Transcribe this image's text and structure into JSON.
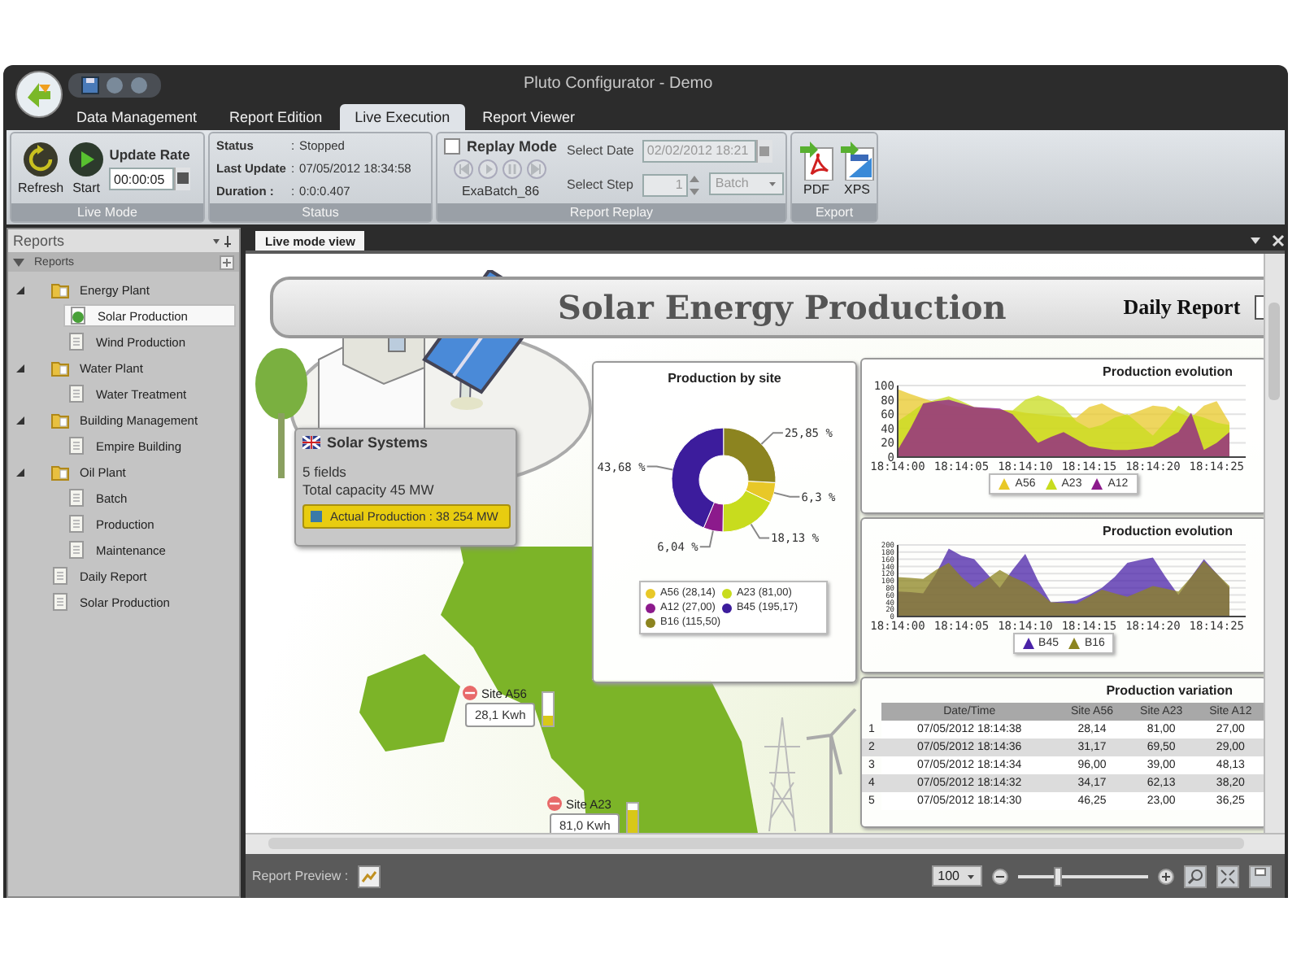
{
  "window": {
    "title": "Pluto Configurator - Demo"
  },
  "ribbon_tabs": [
    {
      "label": "Data Management",
      "selected": false
    },
    {
      "label": "Report Edition",
      "selected": false
    },
    {
      "label": "Live Execution",
      "selected": true
    },
    {
      "label": "Report Viewer",
      "selected": false
    }
  ],
  "ribbon": {
    "live_mode": {
      "label": "Live Mode",
      "buttons": [
        {
          "label": "Refresh",
          "kind": "refresh"
        },
        {
          "label": "Start",
          "kind": "start"
        }
      ],
      "update_rate": {
        "label": "Update Rate",
        "value": "00:00:05"
      }
    },
    "status": {
      "label": "Status",
      "rows": [
        {
          "name": "Status",
          "separator": ":",
          "value": "Stopped"
        },
        {
          "name": "Last Update",
          "separator": ":",
          "value": "07/05/2012 18:34:58"
        },
        {
          "name": "Duration :",
          "separator": ":",
          "value": "0:0:0.407"
        }
      ]
    },
    "report_replay": {
      "label": "Report Replay",
      "replay_mode": {
        "label": "Replay Mode",
        "checked": false
      },
      "media_buttons": [
        {
          "kind": "first",
          "disabled": true
        },
        {
          "kind": "play",
          "disabled": true
        },
        {
          "kind": "pause",
          "disabled": true
        },
        {
          "kind": "last",
          "disabled": true
        }
      ],
      "batch": "ExaBatch_86",
      "select_date": {
        "label": "Select Date",
        "value": "02/02/2012 18:21",
        "disabled": true
      },
      "select_step": {
        "label": "Select Step",
        "value": "1",
        "disabled": true
      },
      "step_unit": {
        "value": "Batch",
        "disabled": true
      }
    },
    "export": {
      "label": "Export",
      "buttons": [
        {
          "label": "PDF",
          "kind": "pdf"
        },
        {
          "label": "XPS",
          "kind": "xps"
        }
      ]
    }
  },
  "reports_panel": {
    "title": "Reports",
    "root": {
      "label": "Reports",
      "expanded": true
    },
    "items": [
      {
        "label": "Energy Plant",
        "kind": "folder",
        "expanded": true,
        "selected": false,
        "children": [
          {
            "label": "Solar Production",
            "kind": "live_report",
            "selected": true
          },
          {
            "label": "Wind Production",
            "kind": "report",
            "selected": false
          }
        ]
      },
      {
        "label": "Water Plant",
        "kind": "folder",
        "expanded": true,
        "selected": false,
        "children": [
          {
            "label": "Water Treatment",
            "kind": "report",
            "selected": false
          }
        ]
      },
      {
        "label": "Building Management",
        "kind": "folder",
        "expanded": true,
        "selected": false,
        "children": [
          {
            "label": "Empire Building",
            "kind": "report",
            "selected": false
          }
        ]
      },
      {
        "label": "Oil Plant",
        "kind": "folder",
        "expanded": true,
        "selected": false,
        "children": [
          {
            "label": "Batch",
            "kind": "report",
            "selected": false
          },
          {
            "label": "Production",
            "kind": "report",
            "selected": false
          },
          {
            "label": "Maintenance",
            "kind": "report",
            "selected": false
          }
        ]
      },
      {
        "label": "Daily Report",
        "kind": "report",
        "selected": false
      },
      {
        "label": "Solar Production",
        "kind": "report",
        "selected": false
      }
    ]
  },
  "document_tabs": [
    {
      "label": "Live mode view",
      "selected": true
    }
  ],
  "report": {
    "title": "Solar Energy Production",
    "subtitle": "Daily Report",
    "info_card": {
      "title": "Solar Systems",
      "lines": [
        "5 fields",
        "Total capacity 45 MW"
      ],
      "button": "Actual Production : 38 254 MW"
    },
    "sites": [
      {
        "name": "Site A56",
        "reading": "28,1 Kwh",
        "level": 0.3
      },
      {
        "name": "Site A23",
        "reading": "81,0 Kwh",
        "level": 0.8
      }
    ],
    "donut_panel": {
      "chart_data": {
        "type": "donut",
        "title": "Production by site",
        "categories": [
          "A56 (28,14)",
          "A23 (81,00)",
          "A12 (27,00)",
          "B45 (195,17)",
          "B16 (115,50)"
        ],
        "values": [
          6.3,
          18.13,
          6.04,
          43.68,
          25.85
        ],
        "value_labels": [
          "6,3 %",
          "18,13 %",
          "6,04 %",
          "43,68 %",
          "25,85 %"
        ],
        "colors": [
          "#e8c828",
          "#c8dc1e",
          "#8c1a8c",
          "#3c1c9c",
          "#8c8420"
        ]
      }
    },
    "evolution_charts": [
      {
        "chart_data": {
          "type": "area",
          "title": "Production evolution",
          "grid": true,
          "categories": [
            "18:14:00",
            null,
            null,
            null,
            null,
            "18:14:05",
            null,
            null,
            null,
            null,
            "18:14:10",
            null,
            null,
            null,
            null,
            "18:14:15",
            null,
            null,
            null,
            null,
            "18:14:20",
            null,
            null,
            null,
            null,
            "18:14:25",
            null
          ],
          "ylim": [
            0,
            100
          ],
          "yticks": [
            0,
            20,
            40,
            60,
            80,
            100
          ],
          "series": [
            {
              "name": "A56",
              "color": "#e8c828",
              "values": [
                95,
                88,
                82,
                76,
                72,
                70,
                68,
                68,
                66,
                65,
                62,
                60,
                58,
                56,
                55,
                70,
                75,
                65,
                58,
                65,
                72,
                70,
                62,
                55,
                72,
                78,
                48
              ]
            },
            {
              "name": "A23",
              "color": "#c8dc1e",
              "values": [
                50,
                62,
                75,
                80,
                85,
                78,
                70,
                68,
                66,
                65,
                80,
                86,
                80,
                70,
                50,
                40,
                45,
                55,
                60,
                45,
                30,
                50,
                72,
                60,
                55,
                48,
                45
              ]
            },
            {
              "name": "A12",
              "color": "#8c1a8c",
              "values": [
                10,
                40,
                75,
                78,
                80,
                75,
                70,
                69,
                68,
                60,
                40,
                20,
                28,
                35,
                25,
                15,
                12,
                10,
                10,
                12,
                15,
                25,
                35,
                62,
                10,
                20,
                35
              ]
            }
          ]
        }
      },
      {
        "chart_data": {
          "type": "area",
          "title": "Production evolution",
          "grid": true,
          "categories": [
            "18:14:00",
            null,
            null,
            null,
            null,
            "18:14:05",
            null,
            null,
            null,
            null,
            "18:14:10",
            null,
            null,
            null,
            null,
            "18:14:15",
            null,
            null,
            null,
            null,
            "18:14:20",
            null,
            null,
            null,
            null,
            "18:14:25",
            null
          ],
          "ylim": [
            0,
            200
          ],
          "yticks": [
            0,
            20,
            40,
            60,
            80,
            100,
            120,
            140,
            160,
            180,
            200
          ],
          "series": [
            {
              "name": "B45",
              "color": "#4a22a8",
              "values": [
                70,
                68,
                65,
                120,
                190,
                170,
                160,
                120,
                80,
                130,
                175,
                100,
                40,
                42,
                45,
                60,
                80,
                110,
                150,
                158,
                165,
                110,
                60,
                110,
                160,
                120,
                80
              ]
            },
            {
              "name": "B16",
              "color": "#8c8420",
              "values": [
                110,
                108,
                105,
                130,
                150,
                110,
                80,
                105,
                130,
                110,
                95,
                70,
                40,
                38,
                35,
                55,
                75,
                65,
                55,
                70,
                85,
                78,
                70,
                110,
                155,
                120,
                85
              ]
            }
          ]
        }
      }
    ],
    "table": {
      "title": "Production variation",
      "columns": [
        "Date/Time",
        "Site A56",
        "Site A23",
        "Site A12"
      ],
      "rows": [
        {
          "index": "1",
          "cells": [
            "07/05/2012 18:14:38",
            "28,14",
            "81,00",
            "27,00"
          ]
        },
        {
          "index": "2",
          "cells": [
            "07/05/2012 18:14:36",
            "31,17",
            "69,50",
            "29,00"
          ]
        },
        {
          "index": "3",
          "cells": [
            "07/05/2012 18:14:34",
            "96,00",
            "39,00",
            "48,13"
          ]
        },
        {
          "index": "4",
          "cells": [
            "07/05/2012 18:14:32",
            "34,17",
            "62,13",
            "38,20"
          ]
        },
        {
          "index": "5",
          "cells": [
            "07/05/2012 18:14:30",
            "46,25",
            "23,00",
            "36,25"
          ]
        }
      ]
    }
  },
  "bottom_bar": {
    "label": "Report Preview :",
    "zoom": "100",
    "zoom_slider": {
      "level": 0.3
    }
  }
}
